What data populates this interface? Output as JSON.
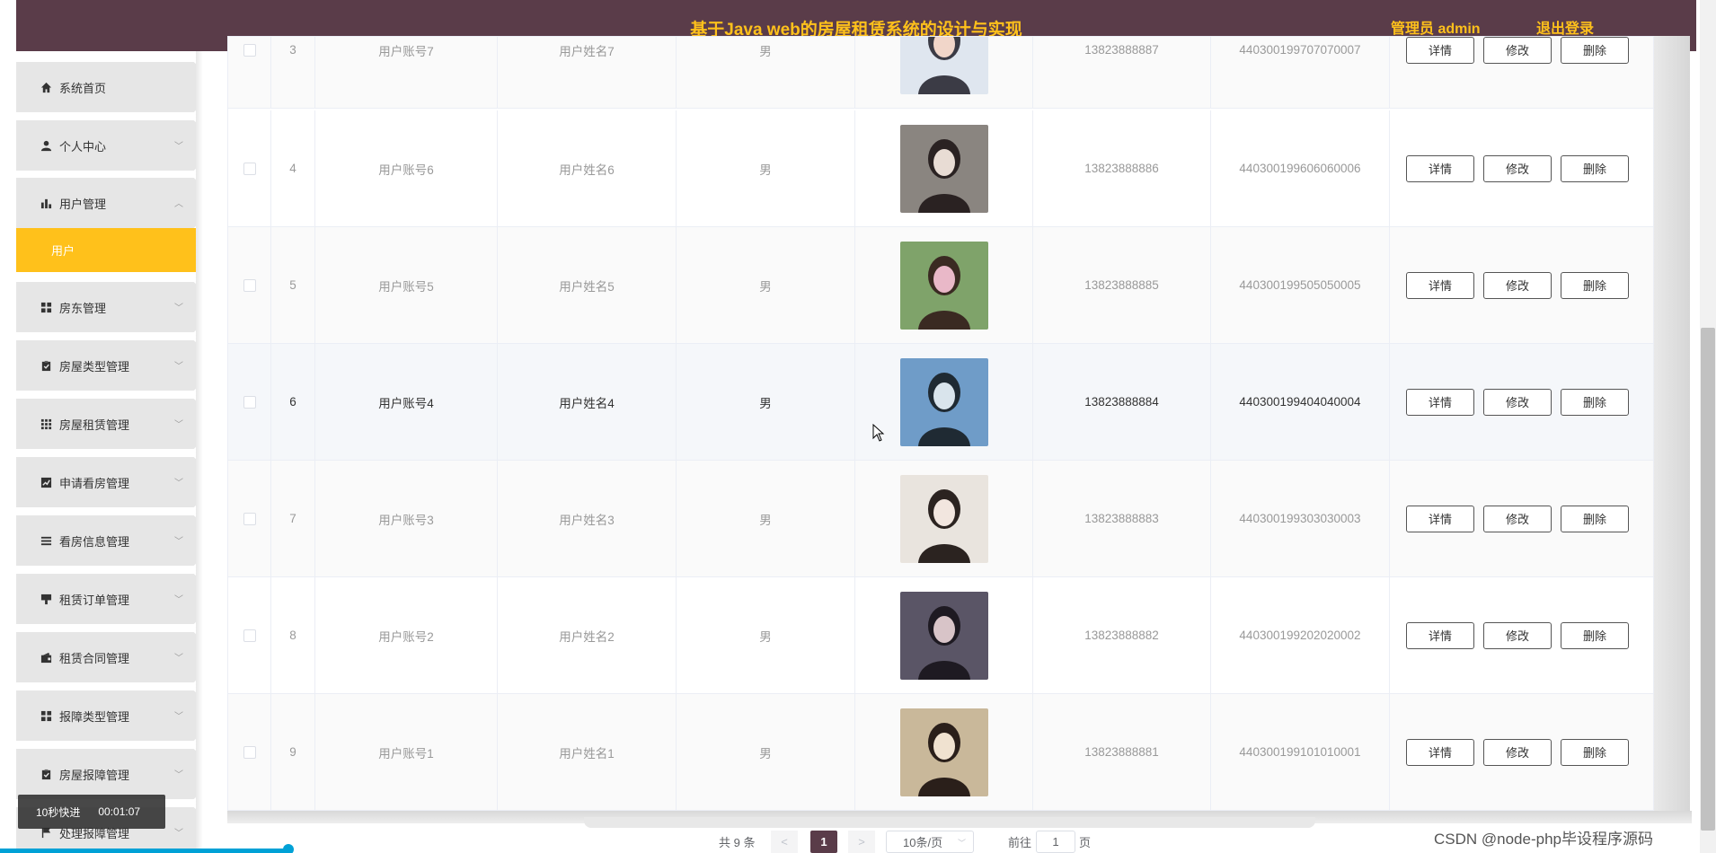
{
  "header": {
    "title": "基于Java web的房屋租赁系统的设计与实现",
    "admin": "管理员 admin",
    "logout": "退出登录"
  },
  "sidebar": {
    "items": [
      {
        "label": "系统首页",
        "icon": "home-icon"
      },
      {
        "label": "个人中心",
        "icon": "user-icon"
      },
      {
        "label": "用户管理",
        "icon": "bar-chart-icon"
      },
      {
        "label": "房东管理",
        "icon": "grid-icon"
      },
      {
        "label": "房屋类型管理",
        "icon": "clipboard-icon"
      },
      {
        "label": "房屋租赁管理",
        "icon": "apps-icon"
      },
      {
        "label": "申请看房管理",
        "icon": "trend-icon"
      },
      {
        "label": "看房信息管理",
        "icon": "list-icon"
      },
      {
        "label": "租赁订单管理",
        "icon": "stamp-icon"
      },
      {
        "label": "租赁合同管理",
        "icon": "wallet-icon"
      },
      {
        "label": "报障类型管理",
        "icon": "grid-icon"
      },
      {
        "label": "房屋报障管理",
        "icon": "clipboard-icon"
      },
      {
        "label": "处理报障管理",
        "icon": "flag-icon"
      }
    ],
    "sub_item": "用户"
  },
  "table": {
    "buttons": {
      "detail": "详情",
      "edit": "修改",
      "delete": "删除"
    },
    "rows": [
      {
        "index": "3",
        "account": "用户账号7",
        "name": "用户姓名7",
        "gender": "男",
        "phone": "13823888887",
        "id_card": "440300199707070007"
      },
      {
        "index": "4",
        "account": "用户账号6",
        "name": "用户姓名6",
        "gender": "男",
        "phone": "13823888886",
        "id_card": "440300199606060006"
      },
      {
        "index": "5",
        "account": "用户账号5",
        "name": "用户姓名5",
        "gender": "男",
        "phone": "13823888885",
        "id_card": "440300199505050005"
      },
      {
        "index": "6",
        "account": "用户账号4",
        "name": "用户姓名4",
        "gender": "男",
        "phone": "13823888884",
        "id_card": "440300199404040004"
      },
      {
        "index": "7",
        "account": "用户账号3",
        "name": "用户姓名3",
        "gender": "男",
        "phone": "13823888883",
        "id_card": "440300199303030003"
      },
      {
        "index": "8",
        "account": "用户账号2",
        "name": "用户姓名2",
        "gender": "男",
        "phone": "13823888882",
        "id_card": "440300199202020002"
      },
      {
        "index": "9",
        "account": "用户账号1",
        "name": "用户姓名1",
        "gender": "男",
        "phone": "13823888881",
        "id_card": "440300199101010001"
      }
    ]
  },
  "pagination": {
    "total": "共 9 条",
    "prev": "<",
    "current": "1",
    "next": ">",
    "page_size": "10条/页",
    "goto": "前往",
    "goto_value": "1",
    "unit": "页"
  },
  "overlay": {
    "fast_forward": "10秒快进",
    "time": "00:01:07",
    "watermark": "CSDN @node-php毕设程序源码"
  },
  "colors": {
    "header_bg": "#5a3c49",
    "accent": "#ffc11b",
    "menu_bg": "#e6e6e6"
  }
}
